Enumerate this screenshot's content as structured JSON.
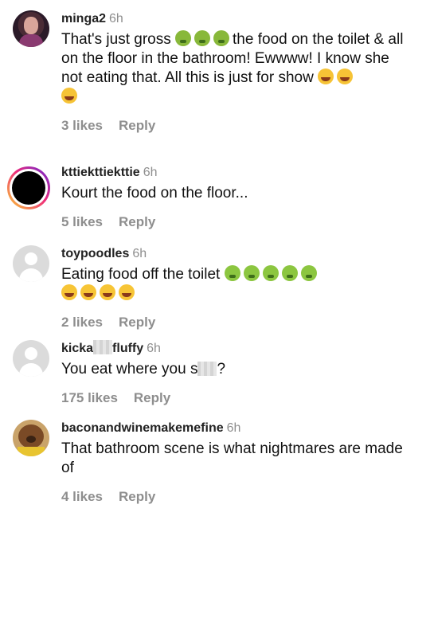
{
  "comments": [
    {
      "username": "minga2",
      "time": "6h",
      "text_parts": [
        "That's just gross",
        "the food on the toilet & all on the floor in the bathroom! Ewwww! I know she not eating that. All this is just for show"
      ],
      "emoji_after_gross": [
        "sick-face",
        "sick-face",
        "sick-face"
      ],
      "emoji_end": [
        "rofl",
        "rofl",
        "rofl"
      ],
      "likes": "3 likes",
      "reply": "Reply"
    },
    {
      "username": "kttiekttiekttie",
      "time": "6h",
      "text": "Kourt the food on the floor...",
      "likes": "5 likes",
      "reply": "Reply"
    },
    {
      "username": "toypoodles",
      "time": "6h",
      "text": "Eating food off the toilet",
      "emoji_line1": [
        "vomit",
        "vomit",
        "vomit",
        "vomit",
        "vomit"
      ],
      "emoji_line2": [
        "tears-of-joy",
        "tears-of-joy",
        "tears-of-joy",
        "tears-of-joy"
      ],
      "likes": "2 likes",
      "reply": "Reply"
    },
    {
      "username_parts": [
        "kicka",
        "fluffy"
      ],
      "time": "6h",
      "text_parts": [
        "You eat where you s",
        "?"
      ],
      "likes": "175 likes",
      "reply": "Reply"
    },
    {
      "username": "baconandwinemakemefine",
      "time": "6h",
      "text": "That bathroom scene is what nightmares are made of",
      "likes": "4 likes",
      "reply": "Reply"
    }
  ]
}
